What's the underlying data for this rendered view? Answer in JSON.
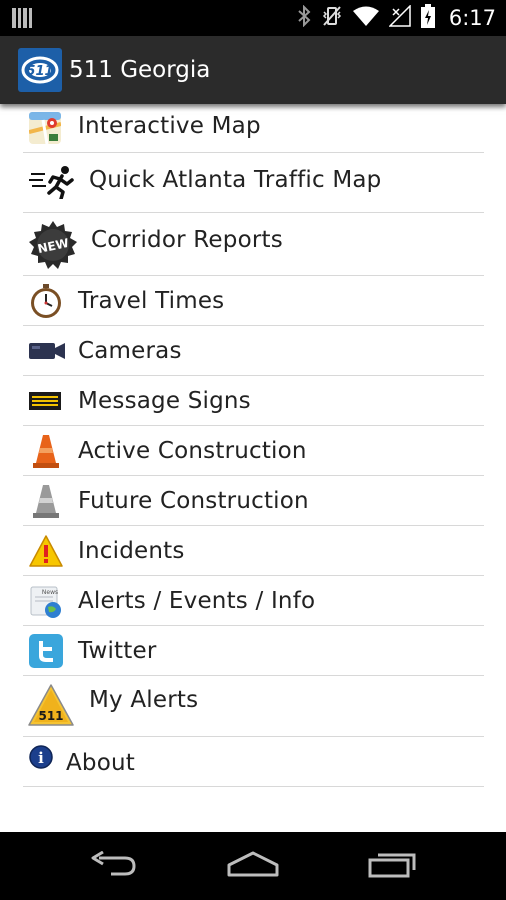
{
  "status_bar": {
    "time": "6:17",
    "icons": [
      "barcode-icon",
      "bluetooth-icon",
      "vibrate-icon",
      "wifi-icon",
      "signal-icon",
      "battery-icon"
    ]
  },
  "app_bar": {
    "title": "511 Georgia",
    "logo_text": "511"
  },
  "menu": {
    "items": [
      {
        "label": "Interactive Map",
        "icon": "map-icon"
      },
      {
        "label": "Quick Atlanta Traffic Map",
        "icon": "runner-icon"
      },
      {
        "label": "Corridor Reports",
        "icon": "new-badge-icon",
        "badge_text": "NEW"
      },
      {
        "label": "Travel Times",
        "icon": "stopwatch-icon"
      },
      {
        "label": "Cameras",
        "icon": "camera-icon"
      },
      {
        "label": "Message Signs",
        "icon": "message-sign-icon"
      },
      {
        "label": "Active Construction",
        "icon": "orange-cone-icon"
      },
      {
        "label": "Future Construction",
        "icon": "gray-cone-icon"
      },
      {
        "label": "Incidents",
        "icon": "warning-icon"
      },
      {
        "label": "Alerts / Events / Info",
        "icon": "news-globe-icon",
        "icon_text": "News"
      },
      {
        "label": "Twitter",
        "icon": "twitter-icon"
      },
      {
        "label": "My Alerts",
        "icon": "alert-511-icon",
        "icon_text": "511"
      },
      {
        "label": "About",
        "icon": "info-icon",
        "icon_text": "i"
      }
    ]
  },
  "nav_bar": {
    "buttons": [
      "back-icon",
      "home-icon",
      "recent-apps-icon"
    ]
  },
  "colors": {
    "action_bar": "#2b2b2b",
    "logo_blue": "#1d5fa8",
    "cone_orange": "#e8631a",
    "warning_yellow": "#f7c600",
    "twitter_blue": "#3aa6dc"
  }
}
